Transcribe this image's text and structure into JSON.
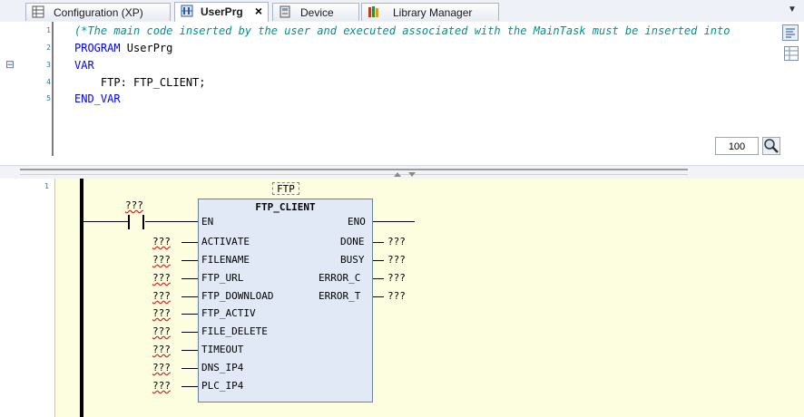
{
  "tabs": [
    {
      "label": "Configuration (XP)",
      "icon": "configuration-icon",
      "active": false
    },
    {
      "label": "UserPrg",
      "icon": "ladder-program-icon",
      "active": true,
      "close": "×"
    },
    {
      "label": "Device",
      "icon": "device-icon",
      "active": false
    },
    {
      "label": "Library Manager",
      "icon": "library-icon",
      "active": false
    }
  ],
  "tab_dropdown": "▼",
  "declaration": {
    "line_numbers": [
      "1",
      "2",
      "3",
      "4",
      "5"
    ],
    "collapse_marker": "⊟",
    "comment": "(*The main code inserted by the user and executed associated with the MainTask must be inserted into",
    "program_kw": "PROGRAM",
    "program_name": " UserPrg",
    "var_kw": "VAR",
    "var_decl": "    FTP: FTP_CLIENT;",
    "end_var_kw": "END_VAR"
  },
  "zoom": "100",
  "ladder": {
    "line_number": "1",
    "instance_name": "FTP",
    "contact_var": "???",
    "fb_type": "FTP_CLIENT",
    "inputs": [
      {
        "pin": "EN",
        "var": ""
      },
      {
        "pin": "ACTIVATE",
        "var": "???"
      },
      {
        "pin": "FILENAME",
        "var": "???"
      },
      {
        "pin": "FTP_URL",
        "var": "???"
      },
      {
        "pin": "FTP_DOWNLOAD",
        "var": "???"
      },
      {
        "pin": "FTP_ACTIV",
        "var": "???"
      },
      {
        "pin": "FILE_DELETE",
        "var": "???"
      },
      {
        "pin": "TIMEOUT",
        "var": "???"
      },
      {
        "pin": "DNS_IP4",
        "var": "???"
      },
      {
        "pin": "PLC_IP4",
        "var": "???"
      }
    ],
    "outputs": [
      {
        "pin": "ENO",
        "var": ""
      },
      {
        "pin": "DONE",
        "var": "???"
      },
      {
        "pin": "BUSY",
        "var": "???"
      },
      {
        "pin": "ERROR_C",
        "var": "???"
      },
      {
        "pin": "ERROR_T",
        "var": "???"
      }
    ]
  }
}
